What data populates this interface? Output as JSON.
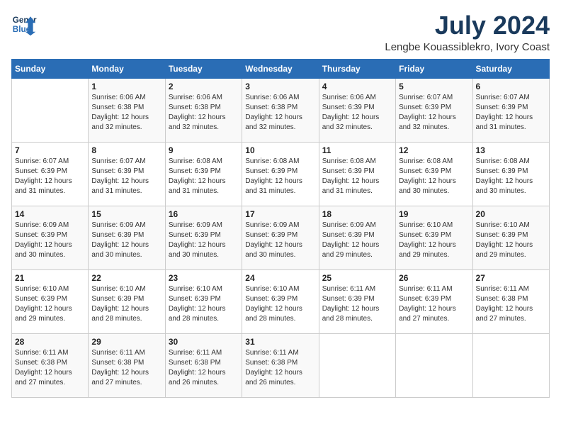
{
  "header": {
    "logo_line1": "General",
    "logo_line2": "Blue",
    "month": "July 2024",
    "location": "Lengbe Kouassiblekro, Ivory Coast"
  },
  "weekdays": [
    "Sunday",
    "Monday",
    "Tuesday",
    "Wednesday",
    "Thursday",
    "Friday",
    "Saturday"
  ],
  "weeks": [
    [
      {
        "day": "",
        "info": ""
      },
      {
        "day": "1",
        "info": "Sunrise: 6:06 AM\nSunset: 6:38 PM\nDaylight: 12 hours\nand 32 minutes."
      },
      {
        "day": "2",
        "info": "Sunrise: 6:06 AM\nSunset: 6:38 PM\nDaylight: 12 hours\nand 32 minutes."
      },
      {
        "day": "3",
        "info": "Sunrise: 6:06 AM\nSunset: 6:38 PM\nDaylight: 12 hours\nand 32 minutes."
      },
      {
        "day": "4",
        "info": "Sunrise: 6:06 AM\nSunset: 6:39 PM\nDaylight: 12 hours\nand 32 minutes."
      },
      {
        "day": "5",
        "info": "Sunrise: 6:07 AM\nSunset: 6:39 PM\nDaylight: 12 hours\nand 32 minutes."
      },
      {
        "day": "6",
        "info": "Sunrise: 6:07 AM\nSunset: 6:39 PM\nDaylight: 12 hours\nand 31 minutes."
      }
    ],
    [
      {
        "day": "7",
        "info": ""
      },
      {
        "day": "8",
        "info": "Sunrise: 6:07 AM\nSunset: 6:39 PM\nDaylight: 12 hours\nand 31 minutes."
      },
      {
        "day": "9",
        "info": "Sunrise: 6:08 AM\nSunset: 6:39 PM\nDaylight: 12 hours\nand 31 minutes."
      },
      {
        "day": "10",
        "info": "Sunrise: 6:08 AM\nSunset: 6:39 PM\nDaylight: 12 hours\nand 31 minutes."
      },
      {
        "day": "11",
        "info": "Sunrise: 6:08 AM\nSunset: 6:39 PM\nDaylight: 12 hours\nand 31 minutes."
      },
      {
        "day": "12",
        "info": "Sunrise: 6:08 AM\nSunset: 6:39 PM\nDaylight: 12 hours\nand 30 minutes."
      },
      {
        "day": "13",
        "info": "Sunrise: 6:08 AM\nSunset: 6:39 PM\nDaylight: 12 hours\nand 30 minutes."
      }
    ],
    [
      {
        "day": "14",
        "info": ""
      },
      {
        "day": "15",
        "info": "Sunrise: 6:09 AM\nSunset: 6:39 PM\nDaylight: 12 hours\nand 30 minutes."
      },
      {
        "day": "16",
        "info": "Sunrise: 6:09 AM\nSunset: 6:39 PM\nDaylight: 12 hours\nand 30 minutes."
      },
      {
        "day": "17",
        "info": "Sunrise: 6:09 AM\nSunset: 6:39 PM\nDaylight: 12 hours\nand 30 minutes."
      },
      {
        "day": "18",
        "info": "Sunrise: 6:09 AM\nSunset: 6:39 PM\nDaylight: 12 hours\nand 29 minutes."
      },
      {
        "day": "19",
        "info": "Sunrise: 6:10 AM\nSunset: 6:39 PM\nDaylight: 12 hours\nand 29 minutes."
      },
      {
        "day": "20",
        "info": "Sunrise: 6:10 AM\nSunset: 6:39 PM\nDaylight: 12 hours\nand 29 minutes."
      }
    ],
    [
      {
        "day": "21",
        "info": ""
      },
      {
        "day": "22",
        "info": "Sunrise: 6:10 AM\nSunset: 6:39 PM\nDaylight: 12 hours\nand 28 minutes."
      },
      {
        "day": "23",
        "info": "Sunrise: 6:10 AM\nSunset: 6:39 PM\nDaylight: 12 hours\nand 28 minutes."
      },
      {
        "day": "24",
        "info": "Sunrise: 6:10 AM\nSunset: 6:39 PM\nDaylight: 12 hours\nand 28 minutes."
      },
      {
        "day": "25",
        "info": "Sunrise: 6:11 AM\nSunset: 6:39 PM\nDaylight: 12 hours\nand 28 minutes."
      },
      {
        "day": "26",
        "info": "Sunrise: 6:11 AM\nSunset: 6:39 PM\nDaylight: 12 hours\nand 27 minutes."
      },
      {
        "day": "27",
        "info": "Sunrise: 6:11 AM\nSunset: 6:38 PM\nDaylight: 12 hours\nand 27 minutes."
      }
    ],
    [
      {
        "day": "28",
        "info": "Sunrise: 6:11 AM\nSunset: 6:38 PM\nDaylight: 12 hours\nand 27 minutes."
      },
      {
        "day": "29",
        "info": "Sunrise: 6:11 AM\nSunset: 6:38 PM\nDaylight: 12 hours\nand 27 minutes."
      },
      {
        "day": "30",
        "info": "Sunrise: 6:11 AM\nSunset: 6:38 PM\nDaylight: 12 hours\nand 26 minutes."
      },
      {
        "day": "31",
        "info": "Sunrise: 6:11 AM\nSunset: 6:38 PM\nDaylight: 12 hours\nand 26 minutes."
      },
      {
        "day": "",
        "info": ""
      },
      {
        "day": "",
        "info": ""
      },
      {
        "day": "",
        "info": ""
      }
    ]
  ],
  "week1_sunday_info": "Sunrise: 6:07 AM\nSunset: 6:39 PM\nDaylight: 12 hours\nand 31 minutes.",
  "week3_sunday_info": "Sunrise: 6:09 AM\nSunset: 6:39 PM\nDaylight: 12 hours\nand 30 minutes.",
  "week4_sunday_info": "Sunrise: 6:10 AM\nSunset: 6:39 PM\nDaylight: 12 hours\nand 29 minutes."
}
